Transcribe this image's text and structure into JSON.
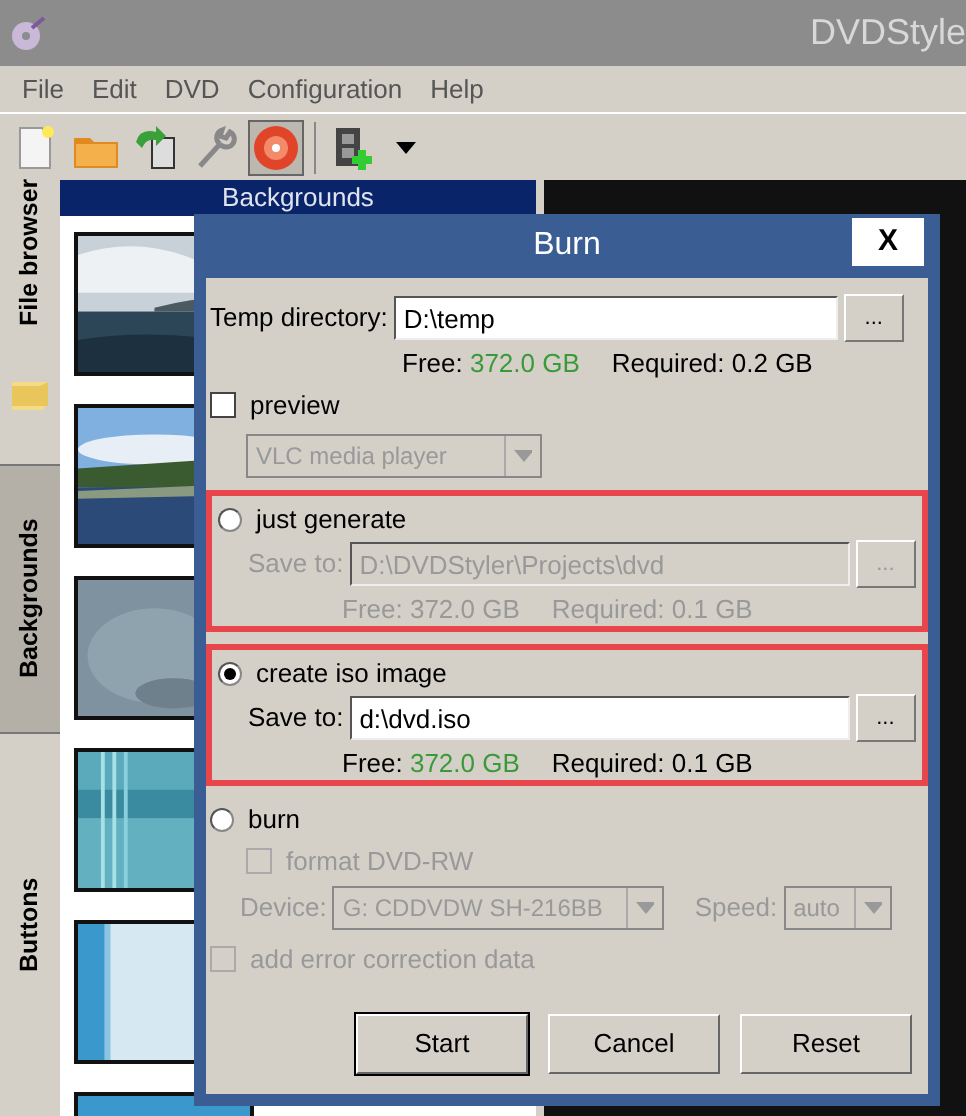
{
  "window": {
    "title": "DVDStyle"
  },
  "menu": [
    "File",
    "Edit",
    "DVD",
    "Configuration",
    "Help"
  ],
  "toolbar": [
    {
      "kind": "new",
      "selected": false
    },
    {
      "kind": "open",
      "selected": false
    },
    {
      "kind": "import",
      "selected": false
    },
    {
      "kind": "settings",
      "selected": false
    },
    {
      "kind": "burn",
      "selected": true
    },
    {
      "kind": "separator"
    },
    {
      "kind": "add-video",
      "selected": false
    },
    {
      "kind": "dropdown",
      "selected": false
    }
  ],
  "side_tabs": [
    {
      "label": "File browser",
      "selected": false,
      "kind": "tab"
    },
    {
      "kind": "folder"
    },
    {
      "label": "Backgrounds",
      "selected": true,
      "kind": "tab"
    },
    {
      "label": "Buttons",
      "selected": false,
      "kind": "tab"
    }
  ],
  "panel": {
    "title": "Backgrounds"
  },
  "dialog": {
    "title": "Burn",
    "close": "X",
    "temp": {
      "label": "Temp directory:",
      "value": "D:\\temp",
      "browse": "...",
      "free_label": "Free:",
      "free": "372.0 GB",
      "required": "Required: 0.2 GB"
    },
    "preview": {
      "label": "preview",
      "checked": false,
      "player": "VLC media player",
      "disabled": true
    },
    "targets": [
      {
        "label": "just generate",
        "selected": false,
        "highlighted": true,
        "disabled": true,
        "save_label": "Save to:",
        "value": "D:\\DVDStyler\\Projects\\dvd",
        "browse": "...",
        "free_label": "Free:",
        "free": "372.0 GB",
        "required": "Required: 0.1 GB"
      },
      {
        "label": "create iso image",
        "selected": true,
        "highlighted": true,
        "disabled": false,
        "save_label": "Save to:",
        "value": "d:\\dvd.iso",
        "browse": "...",
        "free_label": "Free:",
        "free": "372.0 GB",
        "required": "Required: 0.1 GB"
      }
    ],
    "burn": {
      "label": "burn",
      "selected": false,
      "disabled": true,
      "format": {
        "label": "format DVD-RW",
        "checked": false
      },
      "device_label": "Device:",
      "device": "G: CDDVDW SH-216BB",
      "speed_label": "Speed:",
      "speed": "auto"
    },
    "error_correction": {
      "label": "add error correction data",
      "checked": false,
      "disabled": true
    },
    "buttons": [
      {
        "label": "Start",
        "default": true
      },
      {
        "label": "Cancel",
        "default": false
      },
      {
        "label": "Reset",
        "default": false
      }
    ]
  }
}
